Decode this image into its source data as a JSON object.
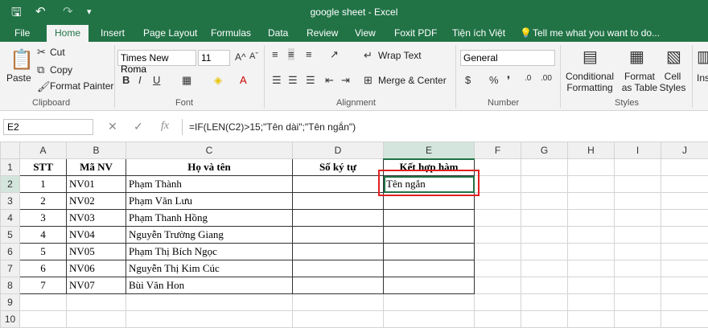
{
  "window": {
    "title": "google sheet - Excel"
  },
  "tabs": [
    "File",
    "Home",
    "Insert",
    "Page Layout",
    "Formulas",
    "Data",
    "Review",
    "View",
    "Foxit PDF",
    "Tiện ích Việt",
    "Tell me what you want to do..."
  ],
  "ribbon": {
    "clipboard": {
      "paste": "Paste",
      "cut": "Cut",
      "copy": "Copy",
      "format_painter": "Format Painter",
      "label": "Clipboard"
    },
    "font": {
      "name": "Times New Roma",
      "size": "11",
      "label": "Font"
    },
    "alignment": {
      "wrap": "Wrap Text",
      "merge": "Merge & Center",
      "label": "Alignment"
    },
    "number": {
      "format": "General",
      "label": "Number"
    },
    "styles": {
      "conditional": "Conditional Formatting",
      "format_table": "Format as Table",
      "cell_styles": "Cell Styles",
      "label": "Styles"
    },
    "insert": "Ins"
  },
  "formula_bar": {
    "name_box": "E2",
    "fx": "fx",
    "formula": "=IF(LEN(C2)>15;\"Tên dài\";\"Tên ngắn\")"
  },
  "columns": [
    "A",
    "B",
    "C",
    "D",
    "E",
    "F",
    "G",
    "H",
    "I",
    "J"
  ],
  "headers": [
    "STT",
    "Mã NV",
    "Họ và tên",
    "Số ký tự",
    "Kết hợp hàm"
  ],
  "rows": [
    {
      "stt": "1",
      "ma": "NV01",
      "ten": "Phạm Thành",
      "e": "Tên ngắn"
    },
    {
      "stt": "2",
      "ma": "NV02",
      "ten": "Phạm Văn Lưu",
      "e": ""
    },
    {
      "stt": "3",
      "ma": "NV03",
      "ten": "Phạm Thanh Hồng",
      "e": ""
    },
    {
      "stt": "4",
      "ma": "NV04",
      "ten": "Nguyễn Trường Giang",
      "e": ""
    },
    {
      "stt": "5",
      "ma": "NV05",
      "ten": "Phạm Thị Bích Ngọc",
      "e": ""
    },
    {
      "stt": "6",
      "ma": "NV06",
      "ten": "Nguyễn Thị Kim Cúc",
      "e": ""
    },
    {
      "stt": "7",
      "ma": "NV07",
      "ten": "Bùi Văn Hon",
      "e": ""
    }
  ],
  "row_numbers": [
    "1",
    "2",
    "3",
    "4",
    "5",
    "6",
    "7",
    "8",
    "9",
    "10"
  ],
  "colors": {
    "accent": "#217346",
    "highlight": "#e02020"
  }
}
